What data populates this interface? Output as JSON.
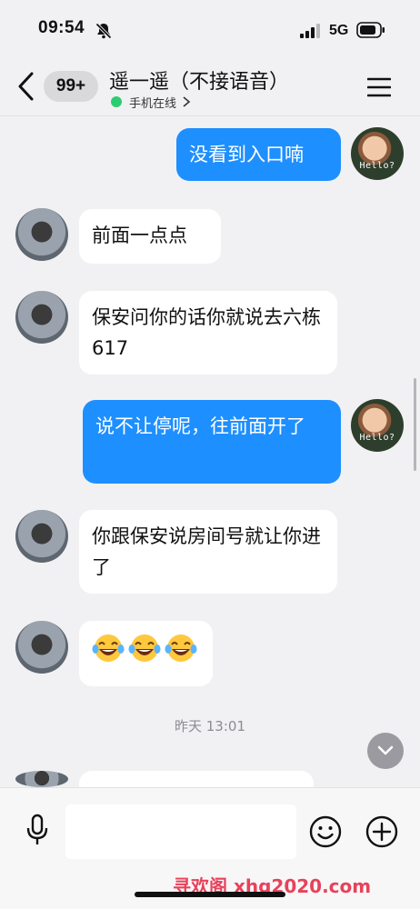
{
  "status_bar": {
    "time": "09:54",
    "network": "5G",
    "icons": [
      "bell-slash-icon",
      "signal-icon",
      "battery-icon"
    ]
  },
  "header": {
    "unread_count": "99+",
    "title": "遥一遥（不接语音）",
    "online_status": "手机在线",
    "status_color": "#2ecc71",
    "icons": [
      "back-chevron-icon",
      "menu-icon",
      "chevron-right-icon"
    ]
  },
  "messages": [
    {
      "side": "out",
      "text": "没看到入口喃",
      "avatar_caption": "Hello?"
    },
    {
      "side": "in",
      "text": "前面一点点"
    },
    {
      "side": "in",
      "text": "保安问你的话你就说去六栋 617"
    },
    {
      "side": "out",
      "text": "说不让停呢，往前面开了",
      "avatar_caption": "Hello?"
    },
    {
      "side": "in",
      "text": "你跟保安说房间号就让你进了"
    },
    {
      "side": "in",
      "emoji": [
        "face-with-tears-of-joy",
        "face-with-tears-of-joy",
        "face-with-tears-of-joy"
      ]
    }
  ],
  "timestamp": "昨天 13:01",
  "colors": {
    "outgoing_bubble": "#1e8fff",
    "incoming_bubble": "#ffffff",
    "background": "#f1f1f3"
  },
  "input_bar": {
    "value": "",
    "icons": [
      "microphone-icon",
      "smiley-icon",
      "plus-circle-icon"
    ]
  },
  "watermark": "寻欢阁 xhg2020.com"
}
